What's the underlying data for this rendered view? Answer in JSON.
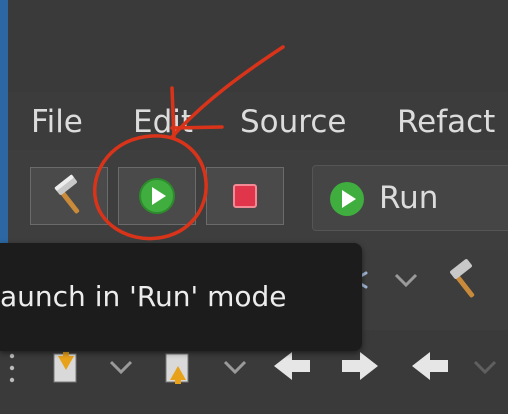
{
  "menu": {
    "file": "File",
    "edit": "Edit",
    "source": "Source",
    "refactor": "Refact"
  },
  "toolbar": {
    "run_config_label": "Run",
    "build_icon": "hammer-icon",
    "run_icon": "play-icon",
    "stop_icon": "stop-icon"
  },
  "tooltip": {
    "text": "aunch in 'Run' mode"
  },
  "colors": {
    "annotation": "#d9341a",
    "run_green": "#3fae3f",
    "stop_red": "#e0354a"
  }
}
